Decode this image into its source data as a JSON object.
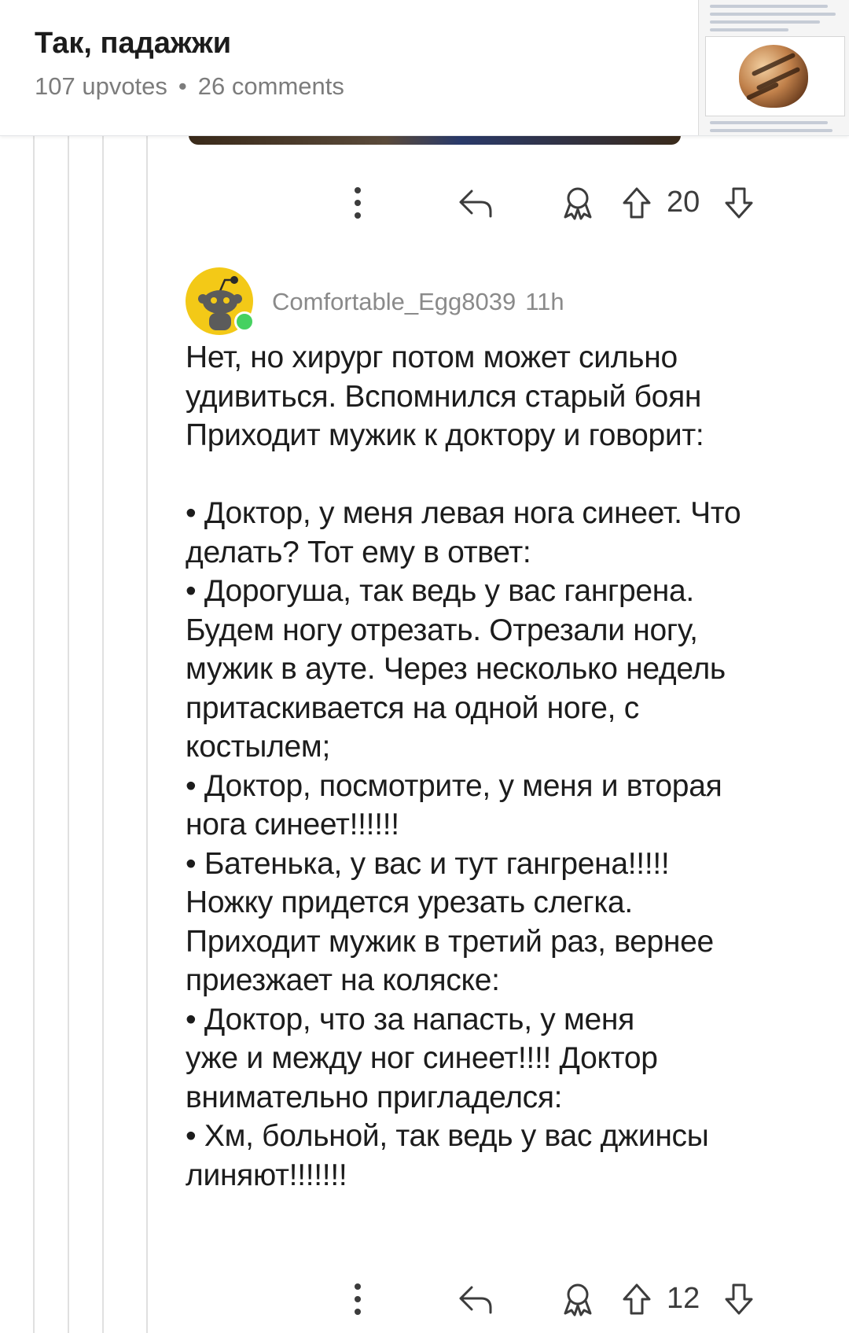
{
  "post": {
    "title": "Так, падажжи",
    "upvotes": "107 upvotes",
    "comments": "26 comments",
    "separator": "•"
  },
  "actions_top": {
    "vote_count": "20"
  },
  "comment": {
    "author": "Comfortable_Egg8039",
    "age": "11h",
    "lines": [
      "Нет, но хирург потом может сильно",
      "удивиться. Вспомнился старый боян",
      "Приходит мужик к доктору и говорит:",
      "",
      "• Доктор, у меня левая нога синеет. Что",
      "делать? Тот ему в ответ:",
      "• Дорогуша, так ведь у вас гангрена.",
      "Будем ногу отрезать. Отрезали ногу,",
      "мужик в ауте. Через несколько недель",
      "притаскивается на одной ноге, с",
      "костылем;",
      "• Доктор, посмотрите, у меня и вторая",
      "нога синеет!!!!!!",
      "• Батенька, у вас и тут гангрена!!!!!",
      "Ножку придется урезать слегка.",
      "Приходит мужик в третий раз, вернее",
      "приезжает на коляске:",
      "• Доктор, что за напасть, у меня",
      "уже и между ног синеет!!!! Доктор",
      "внимательно пригладелся:",
      "• Хм, больной, так ведь у вас джинсы",
      "линяют!!!!!!!"
    ],
    "vote_count": "12"
  },
  "icons": [
    "more-icon",
    "reply-icon",
    "award-icon",
    "upvote-icon",
    "downvote-icon",
    "snoo-avatar-icon"
  ]
}
